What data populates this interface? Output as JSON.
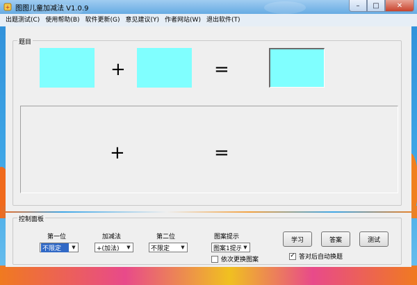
{
  "window": {
    "title": "图图儿童加减法 V1.0.9",
    "app_icon": "app-icon"
  },
  "menubar": {
    "items": [
      {
        "label": "出题测试(C)"
      },
      {
        "label": "使用帮助(B)"
      },
      {
        "label": "软件更新(G)"
      },
      {
        "label": "意见建议(Y)"
      },
      {
        "label": "作者网站(W)"
      },
      {
        "label": "退出软件(T)"
      }
    ]
  },
  "topic": {
    "legend": "题目",
    "plus_sign": "+",
    "equals_sign": "=",
    "box_color": "#80ffff"
  },
  "control": {
    "legend": "控制面板",
    "first": {
      "label": "第一位",
      "value": "不限定"
    },
    "operation": {
      "label": "加减法",
      "value": "+(加法)"
    },
    "second": {
      "label": "第二位",
      "value": "不限定"
    },
    "hint": {
      "label": "图案提示",
      "value": "图案1提示"
    },
    "rotate_checkbox": {
      "label": "依次更换图案",
      "checked": false
    },
    "auto_checkbox": {
      "label": "答对后自动换题",
      "checked": true
    },
    "buttons": {
      "learn": "学习",
      "answer": "答案",
      "test": "测试"
    }
  }
}
